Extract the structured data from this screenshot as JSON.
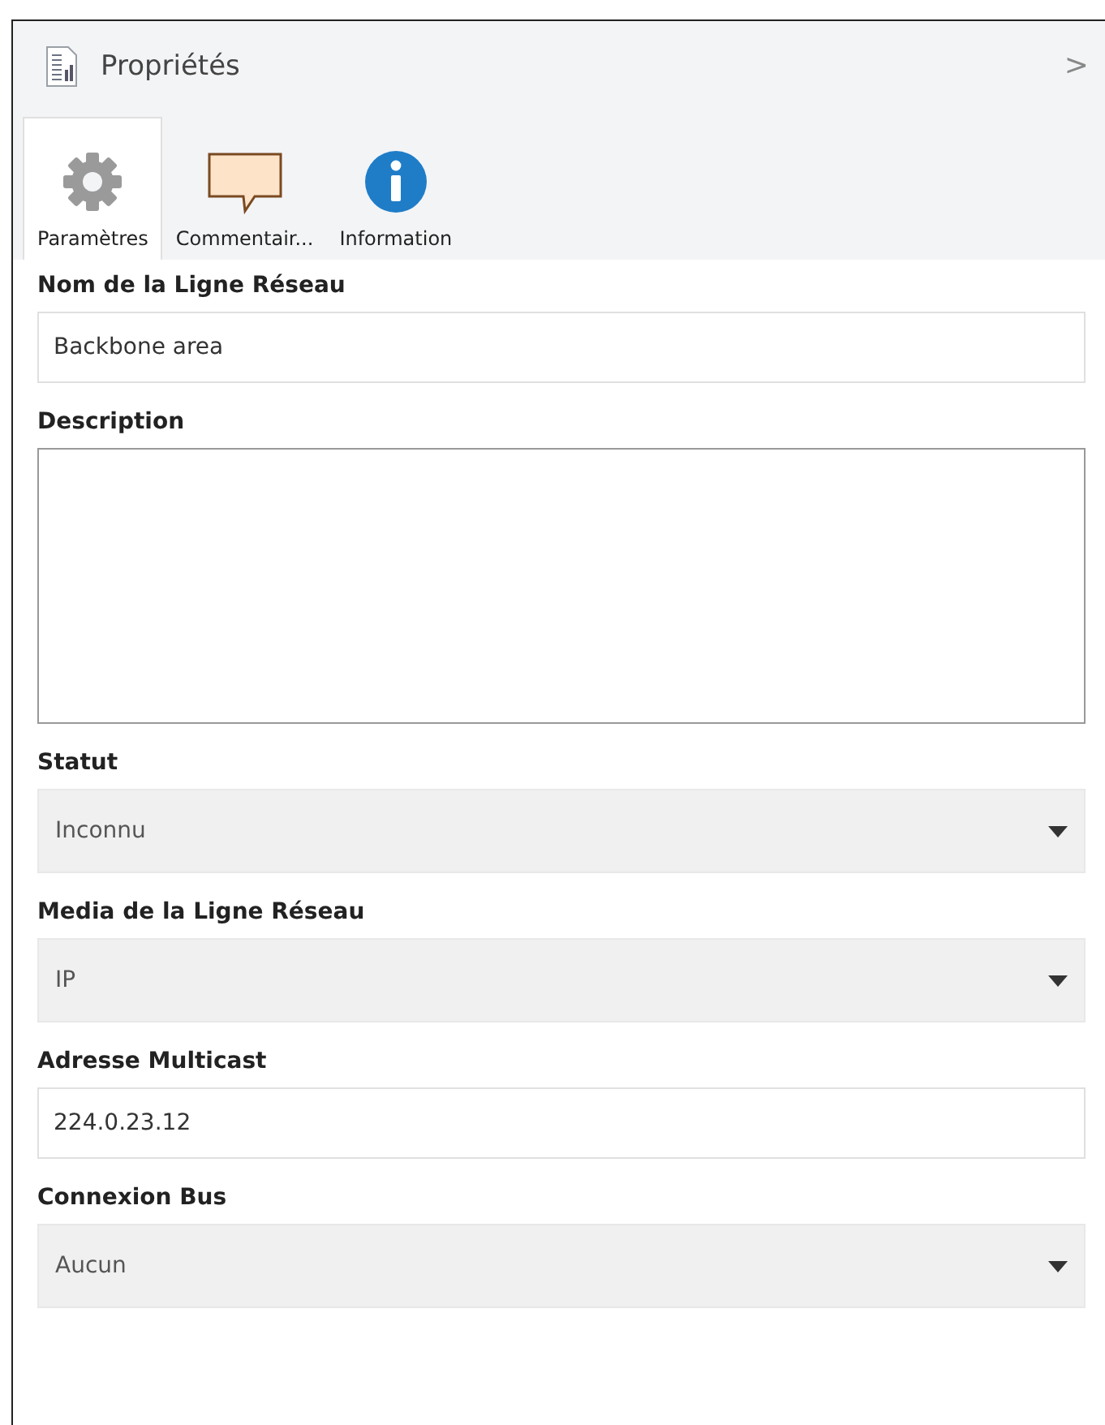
{
  "panel": {
    "title": "Propriétés",
    "collapse_glyph": ">"
  },
  "tabs": [
    {
      "label": "Paramètres",
      "selected": true,
      "kind": "gear"
    },
    {
      "label": "Commentair...",
      "selected": false,
      "kind": "comment"
    },
    {
      "label": "Information",
      "selected": false,
      "kind": "info"
    }
  ],
  "fields": [
    {
      "label": "Nom de la Ligne Réseau",
      "kind": "text",
      "value": "Backbone area"
    },
    {
      "label": "Description",
      "kind": "textarea"
    },
    {
      "label": "Statut",
      "kind": "dropdown",
      "value": "Inconnu"
    },
    {
      "label": "Media de la Ligne Réseau",
      "kind": "dropdown",
      "value": "IP"
    },
    {
      "label": "Adresse Multicast",
      "kind": "text",
      "value": "224.0.23.12"
    },
    {
      "label": "Connexion Bus",
      "kind": "dropdown",
      "value": "Aucun"
    }
  ]
}
